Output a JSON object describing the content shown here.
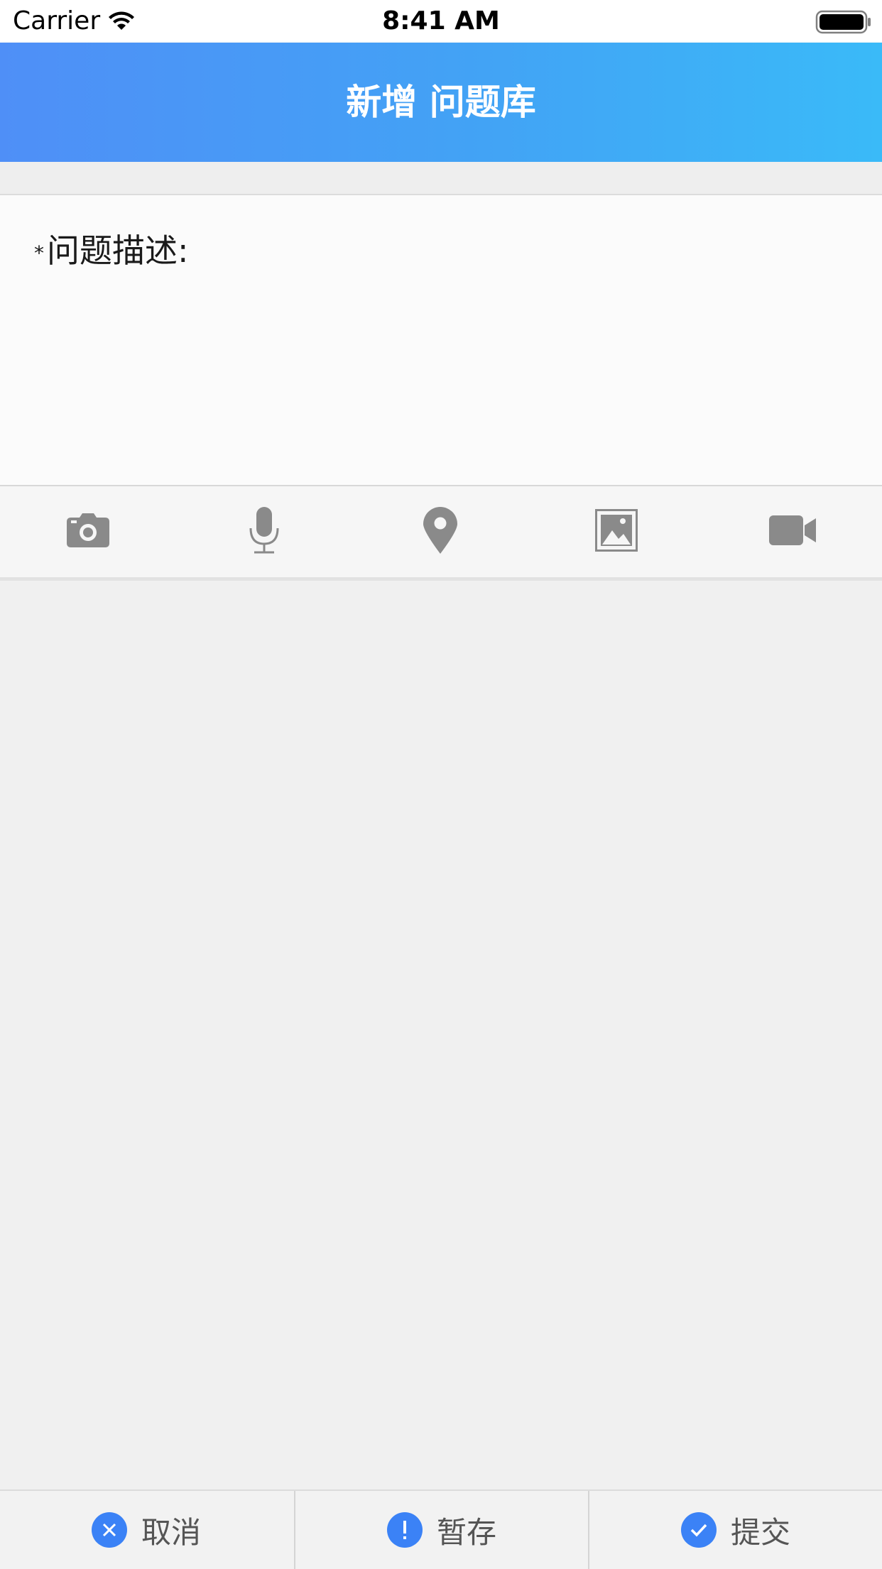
{
  "status_bar": {
    "carrier": "Carrier",
    "time": "8:41 AM"
  },
  "header": {
    "title": "新增 问题库"
  },
  "form": {
    "description_label": "问题描述:",
    "required_mark": "*",
    "description_value": ""
  },
  "toolbar": {
    "icons": [
      "camera-icon",
      "microphone-icon",
      "location-pin-icon",
      "image-icon",
      "video-camera-icon"
    ],
    "icon_color": "#8a8a8a"
  },
  "bottom_bar": {
    "cancel_label": "取消",
    "save_draft_label": "暂存",
    "submit_label": "提交",
    "accent_color": "#3b82f6"
  }
}
